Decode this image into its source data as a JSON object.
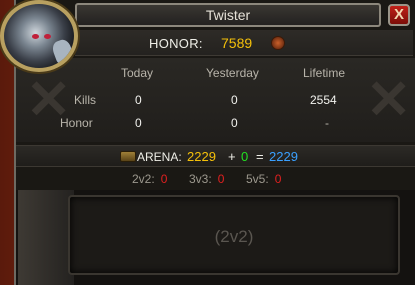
{
  "window": {
    "title": "Twister",
    "close_label": "X"
  },
  "honor": {
    "label": "HONOR:",
    "value": "7589"
  },
  "stats": {
    "columns": [
      "Today",
      "Yesterday",
      "Lifetime"
    ],
    "rows": [
      {
        "label": "Kills",
        "today": "0",
        "yesterday": "0",
        "lifetime": "2554"
      },
      {
        "label": "Honor",
        "today": "0",
        "yesterday": "0",
        "lifetime": "-"
      }
    ]
  },
  "arena": {
    "label": "ARENA:",
    "total": "2229",
    "plus": "+",
    "today": "0",
    "equals": "=",
    "lifetime": "2229"
  },
  "brackets": [
    {
      "name": "2v2:",
      "value": "0"
    },
    {
      "name": "3v3:",
      "value": "0"
    },
    {
      "name": "5v5:",
      "value": "0"
    }
  ],
  "team_slot": {
    "label": "(2v2)"
  },
  "colors": {
    "gold": "#f4c00a",
    "green": "#22e022",
    "blue": "#3aa0ff",
    "red": "#e02020"
  },
  "icons": {
    "portrait": "character-portrait",
    "honor": "honor-coin-icon",
    "arena": "arena-emblem-icon",
    "close": "close-icon"
  }
}
